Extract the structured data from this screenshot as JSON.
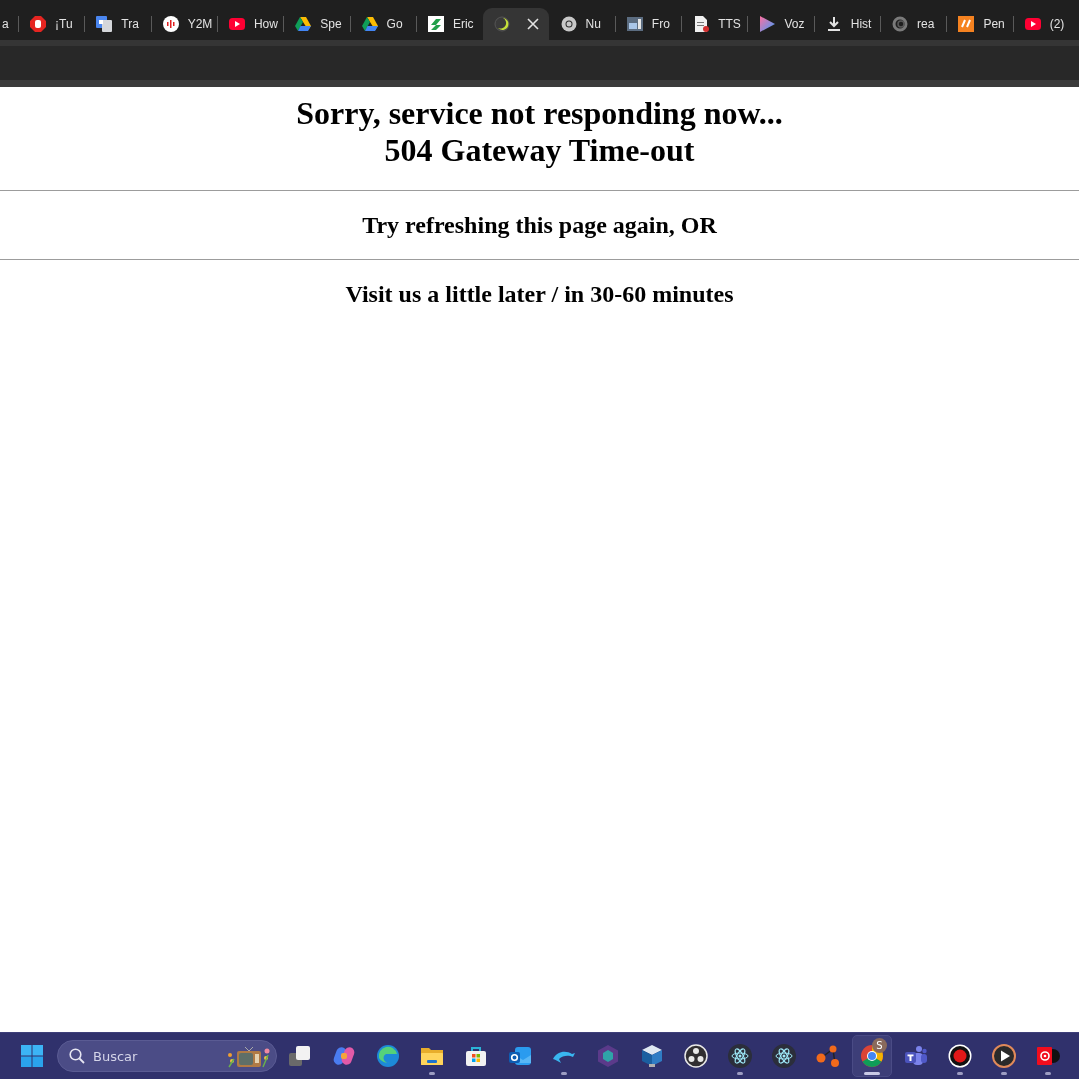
{
  "browser": {
    "tabs": [
      {
        "title": "a",
        "selected": false
      },
      {
        "title": "¡Tu",
        "selected": false
      },
      {
        "title": "Tra",
        "selected": false
      },
      {
        "title": "Y2M",
        "selected": false
      },
      {
        "title": "How",
        "selected": false
      },
      {
        "title": "Spe",
        "selected": false
      },
      {
        "title": "Go",
        "selected": false
      },
      {
        "title": "Eric",
        "selected": false
      },
      {
        "selected": true
      },
      {
        "title": "Nu",
        "selected": false
      },
      {
        "title": "Fro",
        "selected": false
      },
      {
        "title": "TTS",
        "selected": false
      },
      {
        "title": "Voz",
        "selected": false
      },
      {
        "title": "Hist",
        "selected": false
      },
      {
        "title": "rea",
        "selected": false
      },
      {
        "title": "Pen",
        "selected": false
      },
      {
        "title": "(2)",
        "selected": false
      }
    ]
  },
  "page": {
    "error_message": "Sorry, service not responding now...",
    "error_code": "504 Gateway Time-out",
    "retry_hint": "Try refreshing this page again, OR",
    "later_hint": "Visit us a little later / in 30-60 minutes"
  },
  "taskbar": {
    "search": {
      "placeholder": "Buscar"
    },
    "apps": [
      {
        "running": false,
        "selected": false
      },
      {
        "running": false,
        "selected": false
      },
      {
        "running": false,
        "selected": false
      },
      {
        "running": true,
        "selected": false
      },
      {
        "running": false,
        "selected": false
      },
      {
        "running": false,
        "selected": false
      },
      {
        "running": true,
        "selected": false
      },
      {
        "running": false,
        "selected": false
      },
      {
        "running": false,
        "selected": false
      },
      {
        "running": false,
        "selected": false
      },
      {
        "running": true,
        "selected": false
      },
      {
        "running": false,
        "selected": false
      },
      {
        "running": false,
        "selected": false
      },
      {
        "running": true,
        "selected": true,
        "badge": "S"
      },
      {
        "running": false,
        "selected": false
      },
      {
        "running": true,
        "selected": false
      },
      {
        "running": true,
        "selected": false
      },
      {
        "running": true,
        "selected": false
      }
    ]
  }
}
